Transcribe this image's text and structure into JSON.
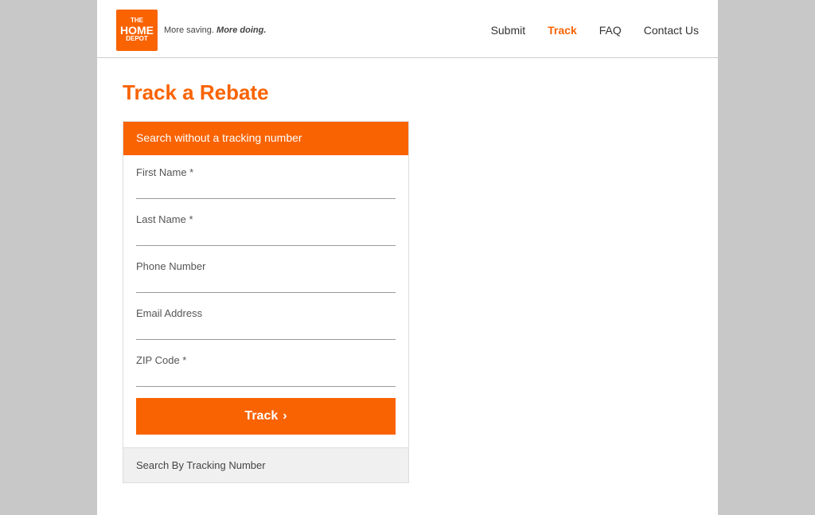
{
  "header": {
    "logo": {
      "line1": "THE",
      "line2": "HOME",
      "line3": "DEPOT",
      "tagline_plain": "More saving.",
      "tagline_bold": "More doing."
    },
    "nav": [
      {
        "label": "Submit",
        "id": "submit",
        "active": false
      },
      {
        "label": "Track",
        "id": "track",
        "active": true
      },
      {
        "label": "FAQ",
        "id": "faq",
        "active": false
      },
      {
        "label": "Contact Us",
        "id": "contact",
        "active": false
      }
    ]
  },
  "main": {
    "page_title": "Track a Rebate",
    "search_card": {
      "header_text": "Search without a tracking number",
      "fields": [
        {
          "label": "First Name *",
          "id": "first-name",
          "type": "text"
        },
        {
          "label": "Last Name *",
          "id": "last-name",
          "type": "text"
        },
        {
          "label": "Phone Number",
          "id": "phone",
          "type": "tel"
        },
        {
          "label": "Email Address",
          "id": "email",
          "type": "email"
        },
        {
          "label": "ZIP Code *",
          "id": "zip",
          "type": "text"
        }
      ],
      "track_button_label": "Track",
      "alternate_search_label": "Search By Tracking Number"
    }
  }
}
